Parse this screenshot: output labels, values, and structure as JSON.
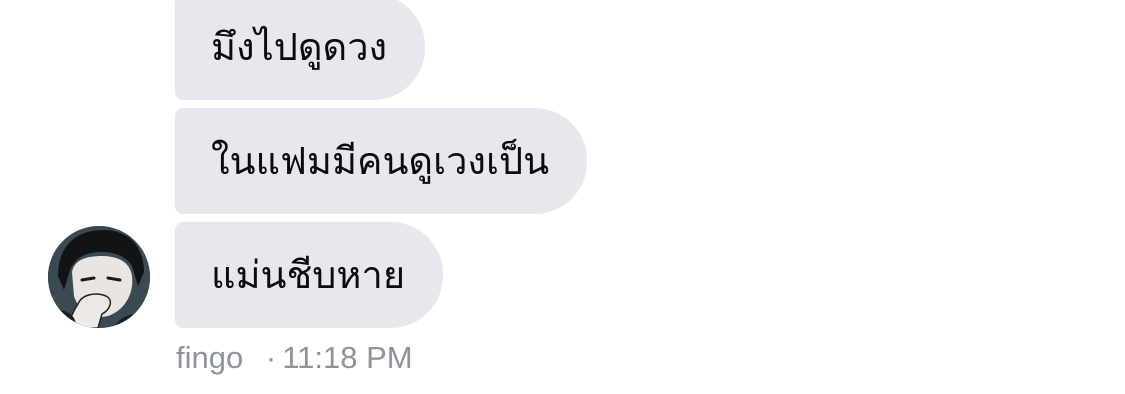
{
  "messages": [
    {
      "text": "มึงไปดูดวง"
    },
    {
      "text": "ในแฟมมีคนดูเวงเป็น"
    },
    {
      "text": "แม่นชีบหาย"
    }
  ],
  "sender": {
    "name": "fingo",
    "separator": "·",
    "time": "11:18 PM"
  },
  "colors": {
    "bubble_bg": "#e7e8ee",
    "meta_text": "#8e939a"
  }
}
